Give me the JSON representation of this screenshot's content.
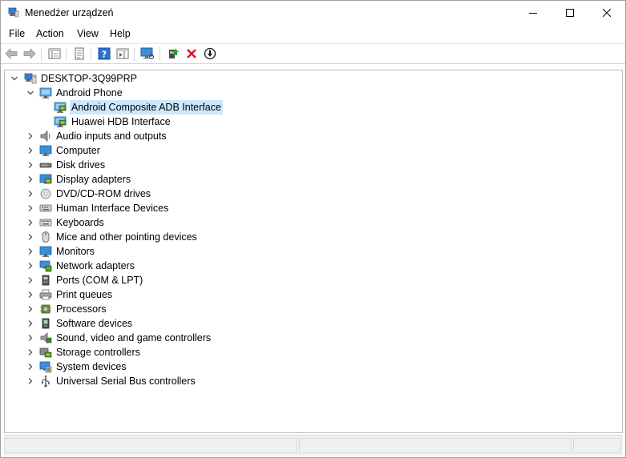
{
  "window": {
    "title": "Menedżer urządzeń"
  },
  "menu": {
    "items": [
      {
        "id": "file",
        "label": "File"
      },
      {
        "id": "action",
        "label": "Action"
      },
      {
        "id": "view",
        "label": "View"
      },
      {
        "id": "help",
        "label": "Help"
      }
    ]
  },
  "toolbar": {
    "buttons": [
      {
        "id": "back",
        "icon": "back-arrow-icon"
      },
      {
        "id": "forward",
        "icon": "forward-arrow-icon"
      },
      {
        "id": "show-hide-console-tree",
        "icon": "console-tree-icon"
      },
      {
        "id": "properties",
        "icon": "properties-icon"
      },
      {
        "id": "help",
        "icon": "help-icon"
      },
      {
        "id": "action-pane",
        "icon": "action-pane-icon"
      },
      {
        "id": "scan-hardware",
        "icon": "monitor-scan-icon"
      },
      {
        "id": "update-driver",
        "icon": "update-driver-icon"
      },
      {
        "id": "uninstall-device",
        "icon": "red-x-icon"
      },
      {
        "id": "disable-device",
        "icon": "down-arrow-circle-icon"
      }
    ]
  },
  "tree": {
    "root": {
      "label": "DESKTOP-3Q99PRP",
      "expanded": true,
      "icon": "computer-icon"
    },
    "categories": [
      {
        "label": "Android Phone",
        "expanded": true,
        "icon": "android-phone-icon",
        "children": [
          {
            "label": "Android Composite ADB Interface",
            "selected": true,
            "icon": "device-interface-icon"
          },
          {
            "label": "Huawei HDB Interface",
            "selected": false,
            "icon": "device-interface-icon"
          }
        ]
      },
      {
        "label": "Audio inputs and outputs",
        "expanded": false,
        "icon": "speaker-icon"
      },
      {
        "label": "Computer",
        "expanded": false,
        "icon": "monitor-icon"
      },
      {
        "label": "Disk drives",
        "expanded": false,
        "icon": "disk-drive-icon"
      },
      {
        "label": "Display adapters",
        "expanded": false,
        "icon": "display-adapter-icon"
      },
      {
        "label": "DVD/CD-ROM drives",
        "expanded": false,
        "icon": "dvd-icon"
      },
      {
        "label": "Human Interface Devices",
        "expanded": false,
        "icon": "hid-icon"
      },
      {
        "label": "Keyboards",
        "expanded": false,
        "icon": "keyboard-icon"
      },
      {
        "label": "Mice and other pointing devices",
        "expanded": false,
        "icon": "mouse-icon"
      },
      {
        "label": "Monitors",
        "expanded": false,
        "icon": "monitor-icon"
      },
      {
        "label": "Network adapters",
        "expanded": false,
        "icon": "network-adapter-icon"
      },
      {
        "label": "Ports (COM & LPT)",
        "expanded": false,
        "icon": "port-icon"
      },
      {
        "label": "Print queues",
        "expanded": false,
        "icon": "printer-icon"
      },
      {
        "label": "Processors",
        "expanded": false,
        "icon": "processor-icon"
      },
      {
        "label": "Software devices",
        "expanded": false,
        "icon": "software-device-icon"
      },
      {
        "label": "Sound, video and game controllers",
        "expanded": false,
        "icon": "sound-icon"
      },
      {
        "label": "Storage controllers",
        "expanded": false,
        "icon": "storage-controller-icon"
      },
      {
        "label": "System devices",
        "expanded": false,
        "icon": "system-device-icon"
      },
      {
        "label": "Universal Serial Bus controllers",
        "expanded": false,
        "icon": "usb-icon"
      }
    ]
  },
  "colors": {
    "selection": "#cce8ff",
    "accent_blue": "#1e8ad6",
    "uninstall_red": "#e81123"
  }
}
